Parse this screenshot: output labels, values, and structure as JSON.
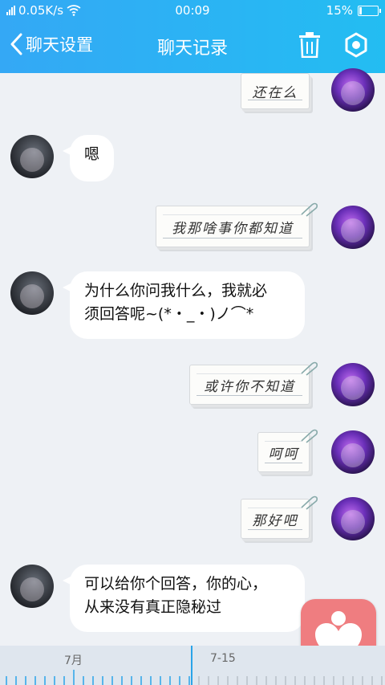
{
  "status_bar": {
    "network_speed": "0.05K/s",
    "time": "00:09",
    "battery": "15%",
    "battery_level": 0.15
  },
  "nav": {
    "back_label": "聊天设置",
    "title": "聊天记录"
  },
  "messages": [
    {
      "from": "self",
      "style": "note",
      "text": "还在么"
    },
    {
      "from": "other",
      "style": "bubble",
      "text": "嗯"
    },
    {
      "from": "self",
      "style": "note",
      "text": "我那啥事你都知道"
    },
    {
      "from": "other",
      "style": "bubble",
      "text_lines": [
        "为什么你问我什么，我就必",
        "须回答呢~(*・_・)ノ⌒*"
      ]
    },
    {
      "from": "self",
      "style": "note",
      "text": "或许你不知道"
    },
    {
      "from": "self",
      "style": "note",
      "text": "呵呵"
    },
    {
      "from": "self",
      "style": "note",
      "text": "那好吧"
    },
    {
      "from": "other",
      "style": "bubble",
      "text_lines": [
        "可以给你个回答，你的心，",
        "从来没有真正隐秘过"
      ]
    }
  ],
  "timeline": {
    "labels": [
      "7月",
      "7-15"
    ]
  },
  "colors": {
    "header": "#2fb0f4",
    "fab": "#ef7d80",
    "timeline_cursor": "#2aa4e8"
  }
}
